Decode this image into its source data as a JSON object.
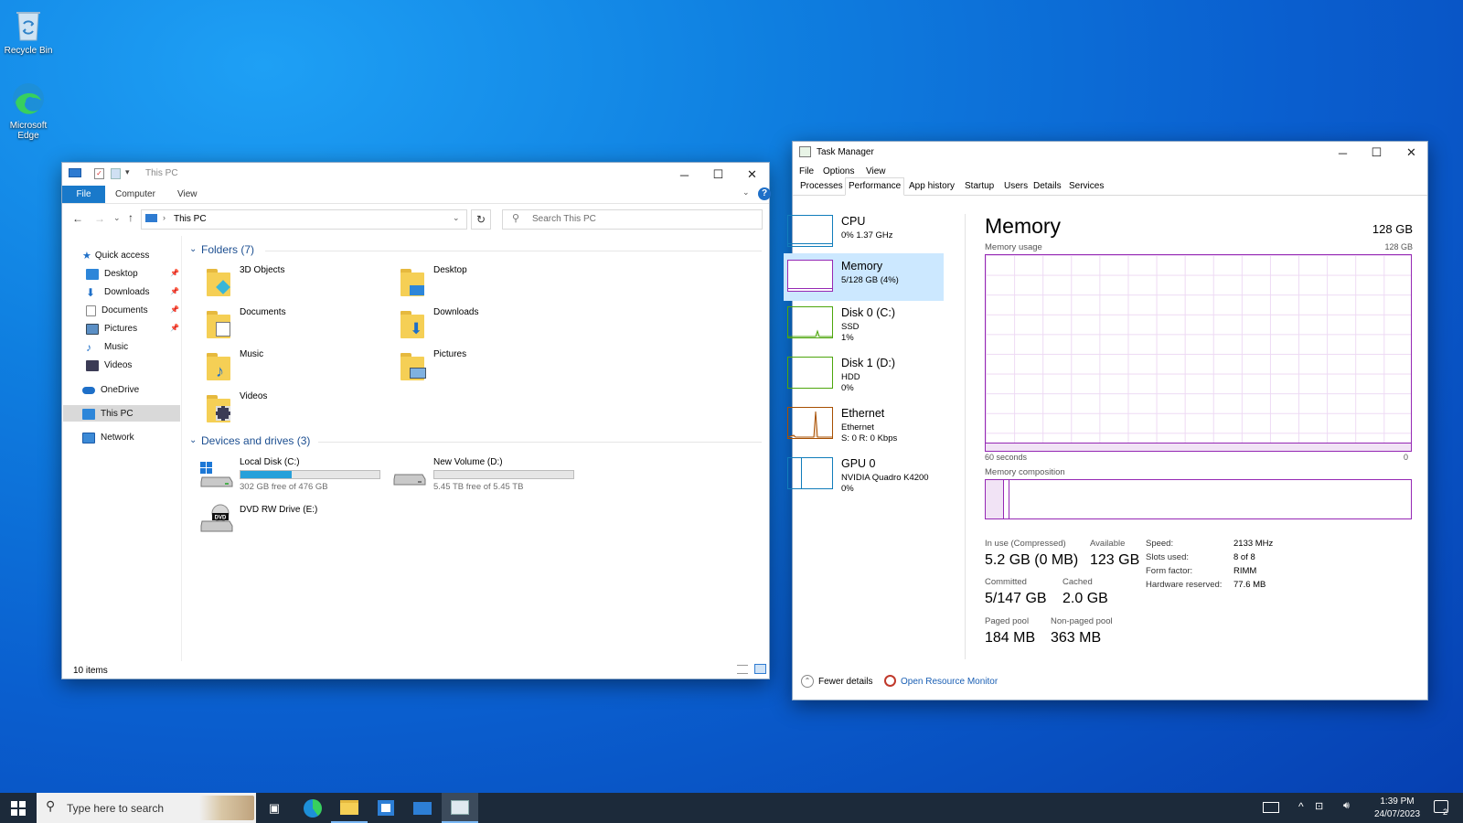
{
  "desktop": {
    "recycle_bin": "Recycle Bin",
    "edge_line1": "Microsoft",
    "edge_line2": "Edge"
  },
  "explorer": {
    "title": "This PC",
    "ribbon_tabs": {
      "file": "File",
      "computer": "Computer",
      "view": "View"
    },
    "address": "This PC",
    "search_placeholder": "Search This PC",
    "nav": {
      "quick_access": "Quick access",
      "desktop": "Desktop",
      "downloads": "Downloads",
      "documents": "Documents",
      "pictures": "Pictures",
      "music": "Music",
      "videos": "Videos",
      "onedrive": "OneDrive",
      "this_pc": "This PC",
      "network": "Network"
    },
    "folders_header": "Folders (7)",
    "folders": {
      "objects3d": "3D Objects",
      "desktop": "Desktop",
      "documents": "Documents",
      "downloads": "Downloads",
      "music": "Music",
      "pictures": "Pictures",
      "videos": "Videos"
    },
    "drives_header": "Devices and drives (3)",
    "drives": {
      "c_name": "Local Disk (C:)",
      "c_free": "302 GB free of 476 GB",
      "c_used_fraction": 0.366,
      "d_name": "New Volume (D:)",
      "d_free": "5.45 TB free of 5.45 TB",
      "d_used_fraction": 0.0,
      "e_name": "DVD RW Drive (E:)",
      "dvd_label": "DVD"
    },
    "status": "10 items"
  },
  "taskmanager": {
    "title": "Task Manager",
    "menu": {
      "file": "File",
      "options": "Options",
      "view": "View"
    },
    "tabs": {
      "processes": "Processes",
      "performance": "Performance",
      "app_history": "App history",
      "startup": "Startup",
      "users": "Users",
      "details": "Details",
      "services": "Services"
    },
    "side": {
      "cpu_title": "CPU",
      "cpu_sub": "0%  1.37 GHz",
      "mem_title": "Memory",
      "mem_sub": "5/128 GB (4%)",
      "disk0_title": "Disk 0 (C:)",
      "disk0_type": "SSD",
      "disk0_pct": "1%",
      "disk1_title": "Disk 1 (D:)",
      "disk1_type": "HDD",
      "disk1_pct": "0%",
      "eth_title": "Ethernet",
      "eth_sub": "Ethernet",
      "eth_rate": "S: 0  R: 0 Kbps",
      "gpu_title": "GPU 0",
      "gpu_sub": "NVIDIA Quadro K4200",
      "gpu_pct": "0%"
    },
    "memory": {
      "heading": "Memory",
      "total": "128 GB",
      "usage_label": "Memory usage",
      "usage_max": "128 GB",
      "time_label": "60 seconds",
      "zero_label": "0",
      "composition_label": "Memory composition",
      "in_use_label": "In use (Compressed)",
      "in_use": "5.2 GB (0 MB)",
      "available_label": "Available",
      "available": "123 GB",
      "committed_label": "Committed",
      "committed": "5/147 GB",
      "cached_label": "Cached",
      "cached": "2.0 GB",
      "paged_label": "Paged pool",
      "paged": "184 MB",
      "nonpaged_label": "Non-paged pool",
      "nonpaged": "363 MB",
      "speed_label": "Speed:",
      "speed": "2133 MHz",
      "slots_label": "Slots used:",
      "slots": "8 of 8",
      "form_label": "Form factor:",
      "form": "RIMM",
      "hwres_label": "Hardware reserved:",
      "hwres": "77.6 MB"
    },
    "fewer_details": "Fewer details",
    "open_resource_monitor": "Open Resource Monitor",
    "colors": {
      "memory": "#9528b4",
      "cpu": "#117dbb",
      "disk": "#4da60c",
      "ethernet": "#a74f01"
    }
  },
  "taskbar": {
    "search_placeholder": "Type here to search",
    "time": "1:39 PM",
    "date": "24/07/2023",
    "notifications": "2"
  }
}
